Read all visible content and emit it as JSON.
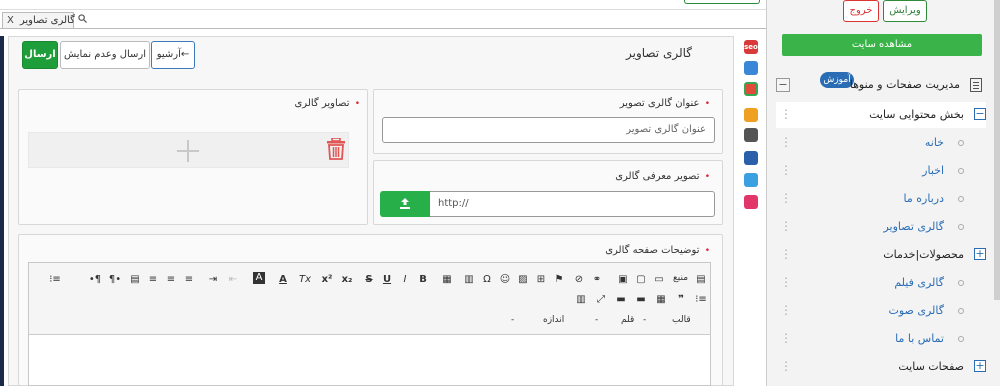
{
  "tab": {
    "title": "گالری تصاویر",
    "close": "X"
  },
  "header": {
    "title": "گالری تصاویر",
    "send_label": "ارسال",
    "send_hide_label": "ارسال وعدم نمایش",
    "archive_label": "آرشیو←"
  },
  "form": {
    "title_label": "عنوان گالری تصویر",
    "title_placeholder": "عنوان گالری تصویر",
    "intro_label": "تصویر معرفی گالری",
    "intro_url": "http://",
    "images_label": "تصاویر گالری",
    "desc_label": "توضیحات صفحه گالری",
    "required_mark": "•"
  },
  "editor": {
    "source_label": "منبع",
    "format_label": "قالب",
    "font_label": "قلم",
    "size_label": "اندازه",
    "toolbar_icons": [
      "source-icon",
      "template-icon",
      "preview-icon",
      "print-icon",
      "paste-icon",
      "link-icon",
      "unlink-icon",
      "anchor-icon",
      "image-icon",
      "smiley-icon",
      "special-char-icon",
      "italic-icon",
      "bold-icon",
      "underline-icon",
      "strike-icon",
      "subscript-icon",
      "superscript-icon",
      "remove-format-icon",
      "text-color-icon",
      "bg-color-icon",
      "outdent-icon",
      "indent-icon",
      "align-left-icon",
      "align-center-icon",
      "align-right-icon",
      "justify-icon",
      "ltr-icon",
      "rtl-icon",
      "list-icon"
    ]
  },
  "sidebar": {
    "edit_label": "ویرایش",
    "logout_label": "خروج",
    "view_site_label": "مشاهده سایت",
    "tutorial_label": "آموزش",
    "manage_label": "مدیریت صفحات و منوها",
    "collapse_label": "−",
    "items": [
      {
        "label": "بخش محتوایی سایت",
        "pm": "−"
      },
      {
        "label": "خانه"
      },
      {
        "label": "اخبار"
      },
      {
        "label": "درباره ما"
      },
      {
        "label": "گالری تصاویر"
      },
      {
        "label": "محصولات|خدمات",
        "pm": "+"
      },
      {
        "label": "گالری فیلم"
      },
      {
        "label": "گالری صوت"
      },
      {
        "label": "تماس با ما"
      },
      {
        "label": "صفحات سایت",
        "pm": "+"
      }
    ]
  },
  "side_icons": [
    "seo-icon",
    "share-icon",
    "google-icon",
    "message-icon",
    "settings-icon",
    "users-icon",
    "chat-icon",
    "lock-icon"
  ],
  "colors": {
    "green": "#1e9e3a",
    "blue": "#2a6db5",
    "red": "#d23"
  }
}
